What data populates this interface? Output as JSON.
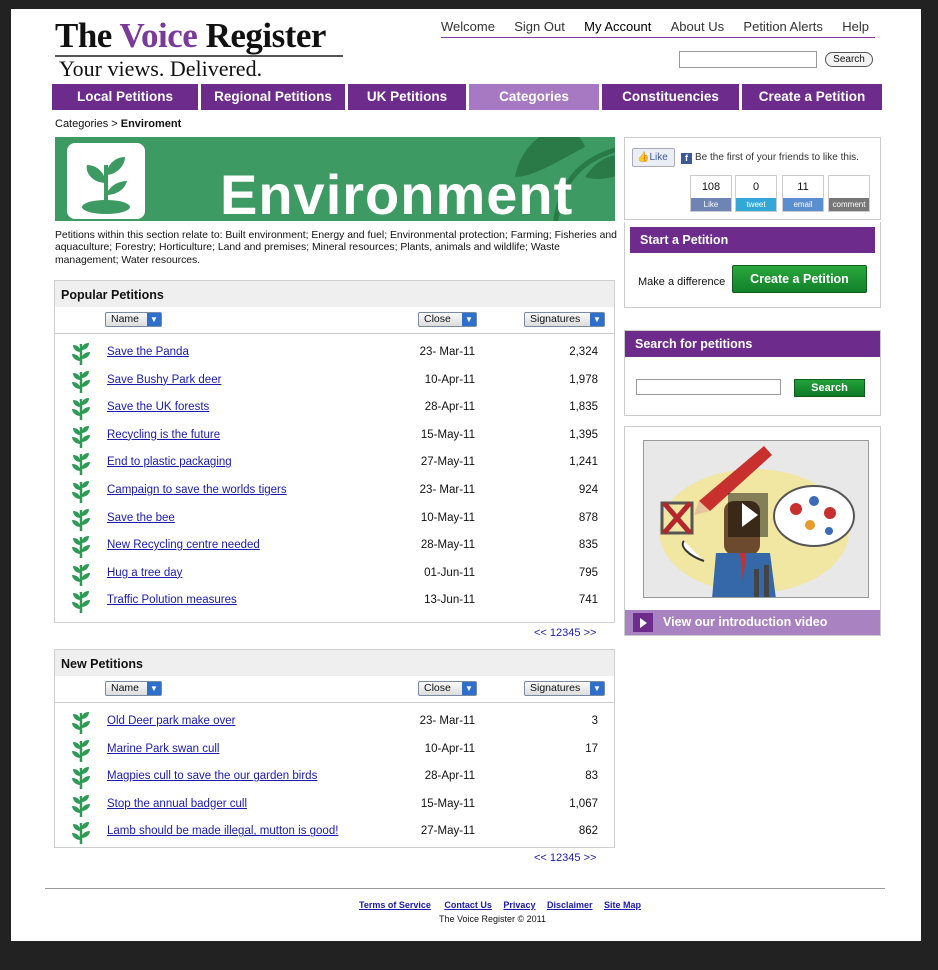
{
  "site": {
    "title_part1": "The ",
    "title_part2": "Voice",
    "title_part3": " Register",
    "tagline": "Your views. Delivered."
  },
  "topnav": [
    "Welcome",
    "Sign Out",
    "My Account",
    "About Us",
    "Petition Alerts",
    "Help"
  ],
  "header_search": {
    "button": "Search",
    "value": ""
  },
  "mainnav": [
    "Local Petitions",
    "Regional Petitions",
    "UK Petitions",
    "Categories",
    "Constituencies",
    "Create a Petition"
  ],
  "mainnav_active": "Categories",
  "breadcrumb": {
    "parent": "Categories",
    "separator": " > ",
    "current": "Enviroment"
  },
  "banner": {
    "title": "Environment"
  },
  "intro": "Petitions within this section relate to: Built environment; Energy and fuel; Environmental protection; Farming; Fisheries and aquaculture; Forestry; Horticulture; Land and premises; Mineral resources; Plants, animals and wildlife; Waste management; Water resources.",
  "popular": {
    "heading": "Popular Petitions",
    "sort": {
      "name": "Name",
      "close": "Close",
      "signatures": "Signatures"
    },
    "rows": [
      {
        "name": "Save the Panda",
        "date": "23- Mar-11",
        "sig": "2,324"
      },
      {
        "name": "Save Bushy Park deer",
        "date": "10-Apr-11",
        "sig": "1,978"
      },
      {
        "name": "Save the UK forests",
        "date": "28-Apr-11",
        "sig": "1,835"
      },
      {
        "name": "Recycling is the future",
        "date": "15-May-11",
        "sig": "1,395"
      },
      {
        "name": "End to plastic packaging",
        "date": "27-May-11",
        "sig": "1,241"
      },
      {
        "name": "Campaign to save the worlds tigers",
        "date": "23- Mar-11",
        "sig": "924"
      },
      {
        "name": "Save the bee",
        "date": "10-May-11",
        "sig": "878"
      },
      {
        "name": "New Recycling centre needed",
        "date": "28-May-11",
        "sig": "835"
      },
      {
        "name": "Hug a tree day",
        "date": "01-Jun-11",
        "sig": "795"
      },
      {
        "name": "Traffic Polution measures",
        "date": "13-Jun-11",
        "sig": "741"
      }
    ],
    "pager": [
      "<<",
      "1",
      "2",
      "3",
      "4",
      "5",
      ">>"
    ]
  },
  "newp": {
    "heading": "New Petitions",
    "sort": {
      "name": "Name",
      "close": "Close",
      "signatures": "Signatures"
    },
    "rows": [
      {
        "name": "Old Deer park make over",
        "date": "23- Mar-11",
        "sig": "3"
      },
      {
        "name": "Marine Park swan cull",
        "date": "10-Apr-11",
        "sig": "17"
      },
      {
        "name": "Magpies cull to save the our garden birds",
        "date": "28-Apr-11",
        "sig": "83"
      },
      {
        "name": "Stop the annual badger cull",
        "date": "15-May-11",
        "sig": "1,067"
      },
      {
        "name": "Lamb should be made illegal, mutton is good!",
        "date": "27-May-11",
        "sig": "862"
      }
    ],
    "pager": [
      "<<",
      "1",
      "2",
      "3",
      "4",
      "5",
      ">>"
    ]
  },
  "social": {
    "like_label": "Like",
    "like_text": "Be the first of your friends to like this.",
    "buttons": [
      {
        "count": "108",
        "label": "Like",
        "color": "#6d84b4"
      },
      {
        "count": "0",
        "label": "tweet",
        "color": "#33a7d8"
      },
      {
        "count": "11",
        "label": "email",
        "color": "#5b8ed0"
      },
      {
        "count": "",
        "label": "comment",
        "color": "#777777"
      }
    ]
  },
  "start_petition": {
    "heading": "Start a Petition",
    "text": "Make a difference",
    "button": "Create a Petition"
  },
  "search_petitions": {
    "heading": "Search for petitions",
    "button": "Search",
    "value": ""
  },
  "video": {
    "label": "View our introduction video"
  },
  "footer": {
    "links": [
      "Terms of Service",
      "Contact Us",
      "Privacy",
      "Disclaimer",
      "Site Map"
    ],
    "copyright": "The Voice Register © 2011"
  },
  "colors": {
    "purple": "#6d2c8c",
    "purple_light": "#a779c3",
    "green_banner": "#3c9a62",
    "button_green": "#12812a",
    "link": "#1a1ab0"
  }
}
